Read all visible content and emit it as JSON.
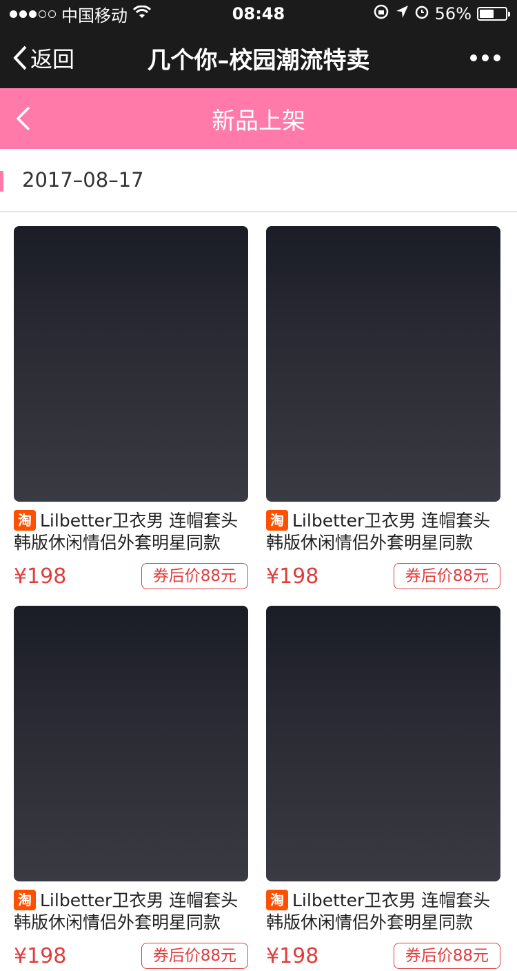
{
  "status": {
    "carrier": "中国移动",
    "time": "08:48",
    "battery": "56%",
    "battery_level": 0.56
  },
  "nav": {
    "back_label": "返回",
    "title": "几个你–校园潮流特卖"
  },
  "header": {
    "title": "新品上架"
  },
  "date": "2017–08–17",
  "colors": {
    "pink": "#ff7aa8",
    "price_red": "#e23c3c",
    "taobao_orange": "#ff5000"
  },
  "products": [
    {
      "badge": "淘",
      "title": "Lilbetter卫衣男 连帽套头韩版休闲情侣外套明星同款",
      "price": "¥198",
      "coupon": "券后价88元"
    },
    {
      "badge": "淘",
      "title": "Lilbetter卫衣男 连帽套头韩版休闲情侣外套明星同款",
      "price": "¥198",
      "coupon": "券后价88元"
    },
    {
      "badge": "淘",
      "title": "Lilbetter卫衣男 连帽套头韩版休闲情侣外套明星同款",
      "price": "¥198",
      "coupon": "券后价88元"
    },
    {
      "badge": "淘",
      "title": "Lilbetter卫衣男 连帽套头韩版休闲情侣外套明星同款",
      "price": "¥198",
      "coupon": "券后价88元"
    }
  ]
}
